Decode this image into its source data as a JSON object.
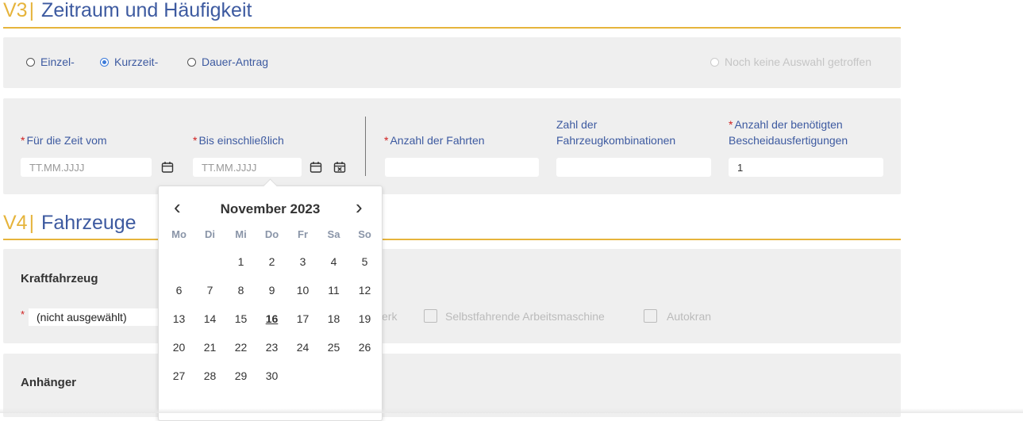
{
  "v3": {
    "code": "V3",
    "separator": "|",
    "title": "Zeitraum und Häufigkeit",
    "options": [
      {
        "label": "Einzel-",
        "checked": false
      },
      {
        "label": "Kurzzeit-",
        "checked": true
      },
      {
        "label": "Dauer-Antrag",
        "checked": false
      }
    ],
    "no_selection_label": "Noch keine Auswahl getroffen",
    "fields": {
      "from_label": "Für die Zeit vom",
      "from_placeholder": "TT.MM.JJJJ",
      "to_label": "Bis einschließlich",
      "to_placeholder": "TT.MM.JJJJ",
      "trips_label": "Anzahl der Fahrten",
      "trips_value": "",
      "combos_label_line1": "Zahl der",
      "combos_label_line2": "Fahrzeugkombinationen",
      "combos_value": "",
      "copies_label_line1": "Anzahl der benötigten",
      "copies_label_line2": "Bescheidausfertigungen",
      "copies_value": "1"
    },
    "required_marker": "*"
  },
  "v4": {
    "code": "V4",
    "separator": "|",
    "title": "Fahrzeuge",
    "kfz_label": "Kraftfahrzeug",
    "kfz_select_value": "(nicht ausgewählt)",
    "partial_checkbox_label": "erk",
    "checkboxes": [
      {
        "label": "Selbstfahrende Arbeitsmaschine",
        "checked": false
      },
      {
        "label": "Autokran",
        "checked": false
      }
    ],
    "trailer_label": "Anhänger"
  },
  "datepicker": {
    "prev_symbol": "‹",
    "next_symbol": "›",
    "month_title": "November 2023",
    "weekdays": [
      "Mo",
      "Di",
      "Mi",
      "Do",
      "Fr",
      "Sa",
      "So"
    ],
    "leading_blanks": 2,
    "days": [
      "1",
      "2",
      "3",
      "4",
      "5",
      "6",
      "7",
      "8",
      "9",
      "10",
      "11",
      "12",
      "13",
      "14",
      "15",
      "16",
      "17",
      "18",
      "19",
      "20",
      "21",
      "22",
      "23",
      "24",
      "25",
      "26",
      "27",
      "28",
      "29",
      "30"
    ],
    "today": "16"
  },
  "colors": {
    "accent": "#e6b43c",
    "title_blue": "#3d5aa0",
    "panel_bg": "#efefef",
    "required": "#d02020",
    "radio_checked": "#3d7bd9"
  },
  "icons": [
    "calendar-icon",
    "calendar-clear-icon",
    "chevron-left-icon",
    "chevron-right-icon"
  ]
}
